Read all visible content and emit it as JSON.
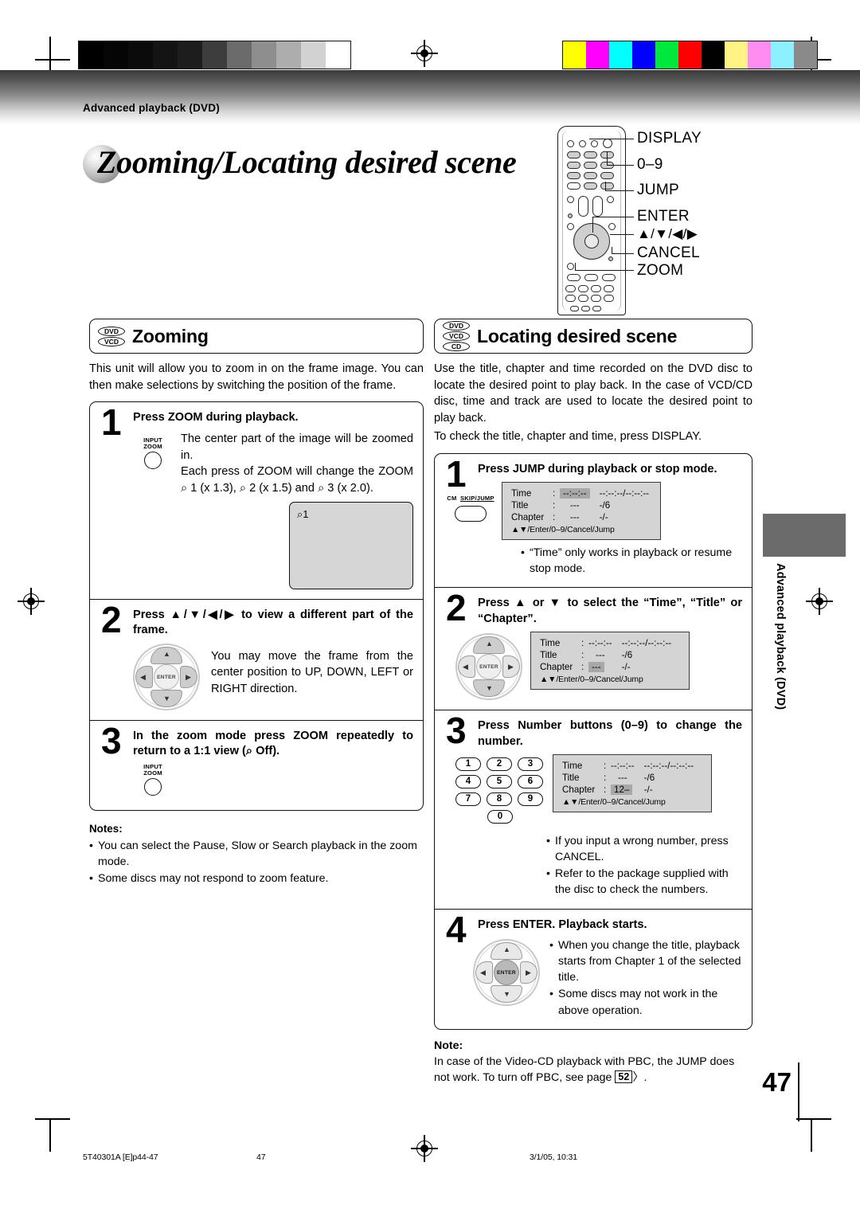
{
  "header": {
    "kicker": "Advanced playback (DVD)",
    "title": "Zooming/Locating desired scene"
  },
  "remote": {
    "callouts": [
      "DISPLAY",
      "0–9",
      "JUMP",
      "ENTER",
      "▲/▼/◀/▶",
      "CANCEL",
      "ZOOM"
    ]
  },
  "left": {
    "badges": [
      "DVD",
      "VCD"
    ],
    "section_title": "Zooming",
    "intro": "This unit will allow you to zoom in on the frame image. You can then make selections by switching the position of the frame.",
    "steps": [
      {
        "num": "1",
        "title": "Press ZOOM during playback.",
        "button": {
          "line1": "INPUT",
          "line2": "ZOOM"
        },
        "text": "The center part of the image will be zoomed in.\nEach press of ZOOM will change the ZOOM ⌕ 1 (x 1.3), ⌕ 2 (x 1.5) and ⌕ 3 (x 2.0).",
        "frame_label": "⌕1"
      },
      {
        "num": "2",
        "title": "Press ▲/▼/◀/▶ to view a different part of the frame.",
        "text": "You may move the frame from the center position to UP, DOWN, LEFT or RIGHT direction.",
        "pad_label": "ENTER"
      },
      {
        "num": "3",
        "title": "In the zoom mode press ZOOM repeatedly to return to a 1:1 view (⌕ Off).",
        "button": {
          "line1": "INPUT",
          "line2": "ZOOM"
        }
      }
    ],
    "notes_heading": "Notes:",
    "notes": [
      "You can select the Pause, Slow or Search playback in the zoom mode.",
      "Some discs may not respond to zoom feature."
    ]
  },
  "right": {
    "badges": [
      "DVD",
      "VCD",
      "CD"
    ],
    "section_title": "Locating desired scene",
    "intro_1": "Use the title, chapter and time recorded on the DVD disc to locate the desired point to play back. In the case of VCD/CD disc, time and track are used to locate the desired point to play back.",
    "intro_2": "To check the title, chapter and time, press DISPLAY.",
    "steps": [
      {
        "num": "1",
        "title": "Press JUMP during playback or stop mode.",
        "button": {
          "line1": "CM",
          "line2": "SKIP/JUMP"
        },
        "osd": {
          "rows": [
            {
              "key": "Time",
              "value": "--:--:--",
              "extra": "--:--:--/--:--:--",
              "highlight": true
            },
            {
              "key": "Title",
              "value": "---",
              "extra": "-/6",
              "highlight": false
            },
            {
              "key": "Chapter",
              "value": "---",
              "extra": "-/-",
              "highlight": false
            }
          ],
          "footer": "▲▼/Enter/0–9/Cancel/Jump"
        },
        "bullets": [
          "“Time” only works in playback or resume stop mode."
        ]
      },
      {
        "num": "2",
        "title": "Press ▲ or ▼ to select the “Time”, “Title” or “Chapter”.",
        "pad_label": "ENTER",
        "osd": {
          "rows": [
            {
              "key": "Time",
              "value": "--:--:--",
              "extra": "--:--:--/--:--:--",
              "highlight": false
            },
            {
              "key": "Title",
              "value": "---",
              "extra": "-/6",
              "highlight": false
            },
            {
              "key": "Chapter",
              "value": "---",
              "extra": "-/-",
              "highlight": true
            }
          ],
          "footer": "▲▼/Enter/0–9/Cancel/Jump"
        }
      },
      {
        "num": "3",
        "title": "Press Number buttons (0–9) to change the number.",
        "keypad": [
          [
            "1",
            "2",
            "3"
          ],
          [
            "4",
            "5",
            "6"
          ],
          [
            "7",
            "8",
            "9"
          ],
          [
            "0"
          ]
        ],
        "osd": {
          "rows": [
            {
              "key": "Time",
              "value": "--:--:--",
              "extra": "--:--:--/--:--:--",
              "highlight": false
            },
            {
              "key": "Title",
              "value": "---",
              "extra": "-/6",
              "highlight": false
            },
            {
              "key": "Chapter",
              "value": "12–",
              "extra": "-/-",
              "highlight": true
            }
          ],
          "footer": "▲▼/Enter/0–9/Cancel/Jump"
        },
        "bullets": [
          "If you input a wrong number, press CANCEL.",
          "Refer to the package supplied with the disc to check the numbers."
        ]
      },
      {
        "num": "4",
        "title": "Press ENTER. Playback starts.",
        "pad_label": "ENTER",
        "bullets": [
          "When you change the title, playback starts from Chapter 1 of the selected title.",
          "Some discs may not work in the above operation."
        ]
      }
    ],
    "note_heading": "Note:",
    "note_text_a": "In case of the Video-CD playback with PBC, the JUMP does not work. To turn off PBC, see page",
    "note_pageref": "52",
    "note_text_b": "〉."
  },
  "sidetab": {
    "label": "Advanced playback (DVD)"
  },
  "page_number": "47",
  "footer": {
    "doc_id": "5T40301A [E]p44-47",
    "page": "47",
    "timestamp": "3/1/05, 10:31"
  },
  "calibration": {
    "grayscale": [
      "#000000",
      "#050505",
      "#0b0b0b",
      "#141414",
      "#1d1d1d",
      "#3d3d3d",
      "#6b6b6b",
      "#8e8e8e",
      "#adadad",
      "#d2d2d2",
      "#ffffff"
    ],
    "colors": [
      "#ffff00",
      "#ff00ff",
      "#00ffff",
      "#0000ff",
      "#00e83c",
      "#ff0000",
      "#000000",
      "#fff384",
      "#ff8cf0",
      "#8cf0ff",
      "#8a8a8a"
    ]
  }
}
